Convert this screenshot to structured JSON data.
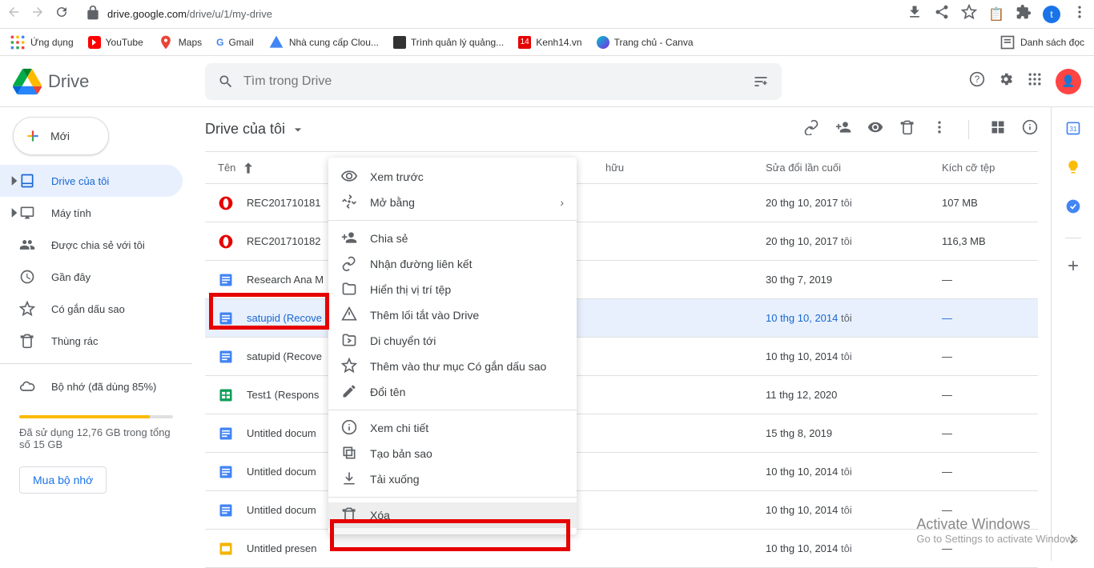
{
  "browser": {
    "url_host": "drive.google.com",
    "url_path": "/drive/u/1/my-drive",
    "avatar_letter": "t",
    "reading_list": "Danh sách đọc"
  },
  "bookmarks": [
    {
      "label": "Ứng dụng",
      "icon": "apps",
      "color": "#5f6368"
    },
    {
      "label": "YouTube",
      "icon": "square",
      "color": "#ff0000"
    },
    {
      "label": "Maps",
      "icon": "pin",
      "color": "#4285f4"
    },
    {
      "label": "Gmail",
      "icon": "mail",
      "color": "#ea4335"
    },
    {
      "label": "Nhà cung cấp Clou...",
      "icon": "triangle",
      "color": "#4285f4"
    },
    {
      "label": "Trình quản lý quảng...",
      "icon": "square",
      "color": "#333"
    },
    {
      "label": "Kenh14.vn",
      "icon": "square",
      "color": "#e60000"
    },
    {
      "label": "Trang chủ - Canva",
      "icon": "circle",
      "color": "#00c4cc"
    }
  ],
  "drive_title": "Drive",
  "search": {
    "placeholder": "Tìm trong Drive"
  },
  "new_btn": "Mới",
  "sidebar": [
    {
      "label": "Drive của tôi",
      "active": true,
      "icon": "drive",
      "expandable": true
    },
    {
      "label": "Máy tính",
      "icon": "computer",
      "expandable": true
    },
    {
      "label": "Được chia sẻ với tôi",
      "icon": "shared"
    },
    {
      "label": "Gần đây",
      "icon": "clock"
    },
    {
      "label": "Có gắn dấu sao",
      "icon": "star"
    },
    {
      "label": "Thùng rác",
      "icon": "trash"
    }
  ],
  "storage": {
    "label": "Bộ nhớ (đã dùng 85%)",
    "detail": "Đã sử dụng 12,76 GB trong tổng số 15 GB",
    "buy": "Mua bộ nhớ"
  },
  "breadcrumb": "Drive của tôi",
  "columns": {
    "name": "Tên",
    "owner": "hữu",
    "modified": "Sửa đổi lần cuối",
    "size": "Kích cỡ tệp"
  },
  "files": [
    {
      "name": "REC201710181",
      "type": "opera",
      "mod": "20 thg 10, 2017",
      "owner": "tôi",
      "size": "107 MB"
    },
    {
      "name": "REC201710182",
      "type": "opera",
      "mod": "20 thg 10, 2017",
      "owner": "tôi",
      "size": "116,3 MB"
    },
    {
      "name": "Research Ana M",
      "type": "doc",
      "mod": "30 thg 7, 2019",
      "owner": "",
      "size": "—"
    },
    {
      "name": "satupid (Recove",
      "type": "doc",
      "mod": "10 thg 10, 2014",
      "owner": "tôi",
      "size": "—",
      "selected": true
    },
    {
      "name": "satupid (Recove",
      "type": "doc",
      "mod": "10 thg 10, 2014",
      "owner": "tôi",
      "size": "—"
    },
    {
      "name": "Test1 (Respons",
      "type": "sheet",
      "mod": "11 thg 12, 2020",
      "owner": "",
      "size": "—"
    },
    {
      "name": "Untitled docum",
      "type": "doc",
      "mod": "15 thg 8, 2019",
      "owner": "",
      "size": "—"
    },
    {
      "name": "Untitled docum",
      "type": "doc",
      "mod": "10 thg 10, 2014",
      "owner": "tôi",
      "size": "—"
    },
    {
      "name": "Untitled docum",
      "type": "doc",
      "mod": "10 thg 10, 2014",
      "owner": "tôi",
      "size": "—"
    },
    {
      "name": "Untitled presen",
      "type": "slide",
      "mod": "10 thg 10, 2014",
      "owner": "tôi",
      "size": "—"
    }
  ],
  "context_menu": [
    {
      "label": "Xem trước",
      "icon": "eye"
    },
    {
      "label": "Mở bằng",
      "icon": "open",
      "arrow": true
    },
    {
      "sep": true
    },
    {
      "label": "Chia sẻ",
      "icon": "person-add"
    },
    {
      "label": "Nhận đường liên kết",
      "icon": "link"
    },
    {
      "label": "Hiển thị vị trí tệp",
      "icon": "folder"
    },
    {
      "label": "Thêm lối tắt vào Drive",
      "icon": "shortcut"
    },
    {
      "label": "Di chuyển tới",
      "icon": "move"
    },
    {
      "label": "Thêm vào thư mục Có gắn dấu sao",
      "icon": "star"
    },
    {
      "label": "Đổi tên",
      "icon": "rename"
    },
    {
      "sep": true
    },
    {
      "label": "Xem chi tiết",
      "icon": "info"
    },
    {
      "label": "Tạo bản sao",
      "icon": "copy"
    },
    {
      "label": "Tải xuống",
      "icon": "download"
    },
    {
      "sep": true
    },
    {
      "label": "Xóa",
      "icon": "trash",
      "hl": true
    }
  ],
  "activate": {
    "line1": "Activate Windows",
    "line2": "Go to Settings to activate Windows"
  }
}
